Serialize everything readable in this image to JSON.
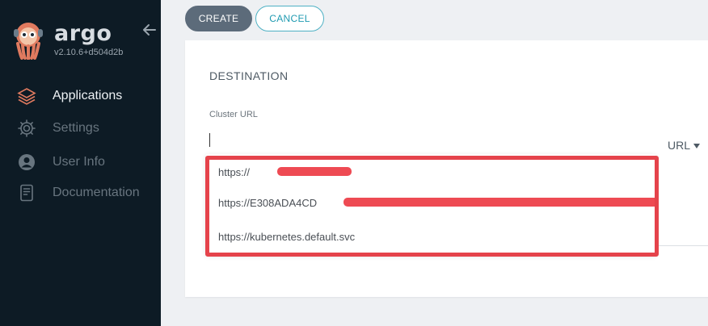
{
  "sidebar": {
    "brand": "argo",
    "version": "v2.10.6+d504d2b",
    "items": [
      {
        "label": "Applications",
        "icon": "layers-icon",
        "active": true
      },
      {
        "label": "Settings",
        "icon": "gear-icon",
        "active": false
      },
      {
        "label": "User Info",
        "icon": "user-icon",
        "active": false
      },
      {
        "label": "Documentation",
        "icon": "book-icon",
        "active": false
      }
    ]
  },
  "toolbar": {
    "create_label": "CREATE",
    "cancel_label": "CANCEL"
  },
  "destination": {
    "section_title": "DESTINATION",
    "cluster_url_label": "Cluster URL",
    "cluster_url_value": "",
    "mode_toggle": "URL",
    "options": [
      "https://",
      "https://E308ADA4CD",
      "https://kubernetes.default.svc"
    ]
  },
  "colors": {
    "sidebar_bg": "#0d1b25",
    "accent": "#1f9ab1",
    "redaction": "#ee4a53",
    "highlight": "#e5434b"
  }
}
